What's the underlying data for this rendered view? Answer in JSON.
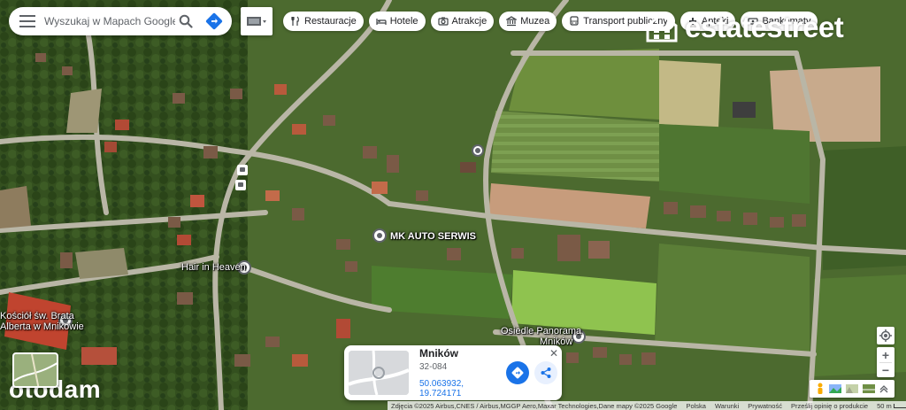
{
  "search": {
    "placeholder": "Wyszukaj w Mapach Google"
  },
  "chips": [
    {
      "label": "Restauracje",
      "icon": "fork-knife-icon"
    },
    {
      "label": "Hotele",
      "icon": "bed-icon"
    },
    {
      "label": "Atrakcje",
      "icon": "camera-icon"
    },
    {
      "label": "Muzea",
      "icon": "museum-icon"
    },
    {
      "label": "Transport publiczny",
      "icon": "bus-icon"
    },
    {
      "label": "Apteki",
      "icon": "pharmacy-icon"
    },
    {
      "label": "Bankomaty",
      "icon": "atm-icon"
    }
  ],
  "map_labels": {
    "auto_serwis": "MK AUTO SERWIS",
    "hair": "Hair in Heaven",
    "church_1": "Kościół św. Brata",
    "church_2": "Alberta w Mnikowie",
    "osiedle_1": "Osiedle Panorama",
    "osiedle_2": "Mników"
  },
  "card": {
    "name": "Mników",
    "postal": "32-084",
    "coords": "50.063932, 19.724171"
  },
  "footer": {
    "attribution": "Zdjęcia ©2025 Airbus,CNES / Airbus,MGGP Aero,Maxar Technologies,Dane mapy ©2025 Google",
    "links": [
      "Polska",
      "Warunki",
      "Prywatność",
      "Prześlij opinię o produkcie"
    ],
    "scale": "50 m"
  },
  "watermarks": {
    "estatestreet": "estatestreet",
    "otodam": "otodam"
  },
  "colors": {
    "accent": "#1a73e8",
    "directions": "#188038",
    "card_bg": "#ffffff"
  }
}
